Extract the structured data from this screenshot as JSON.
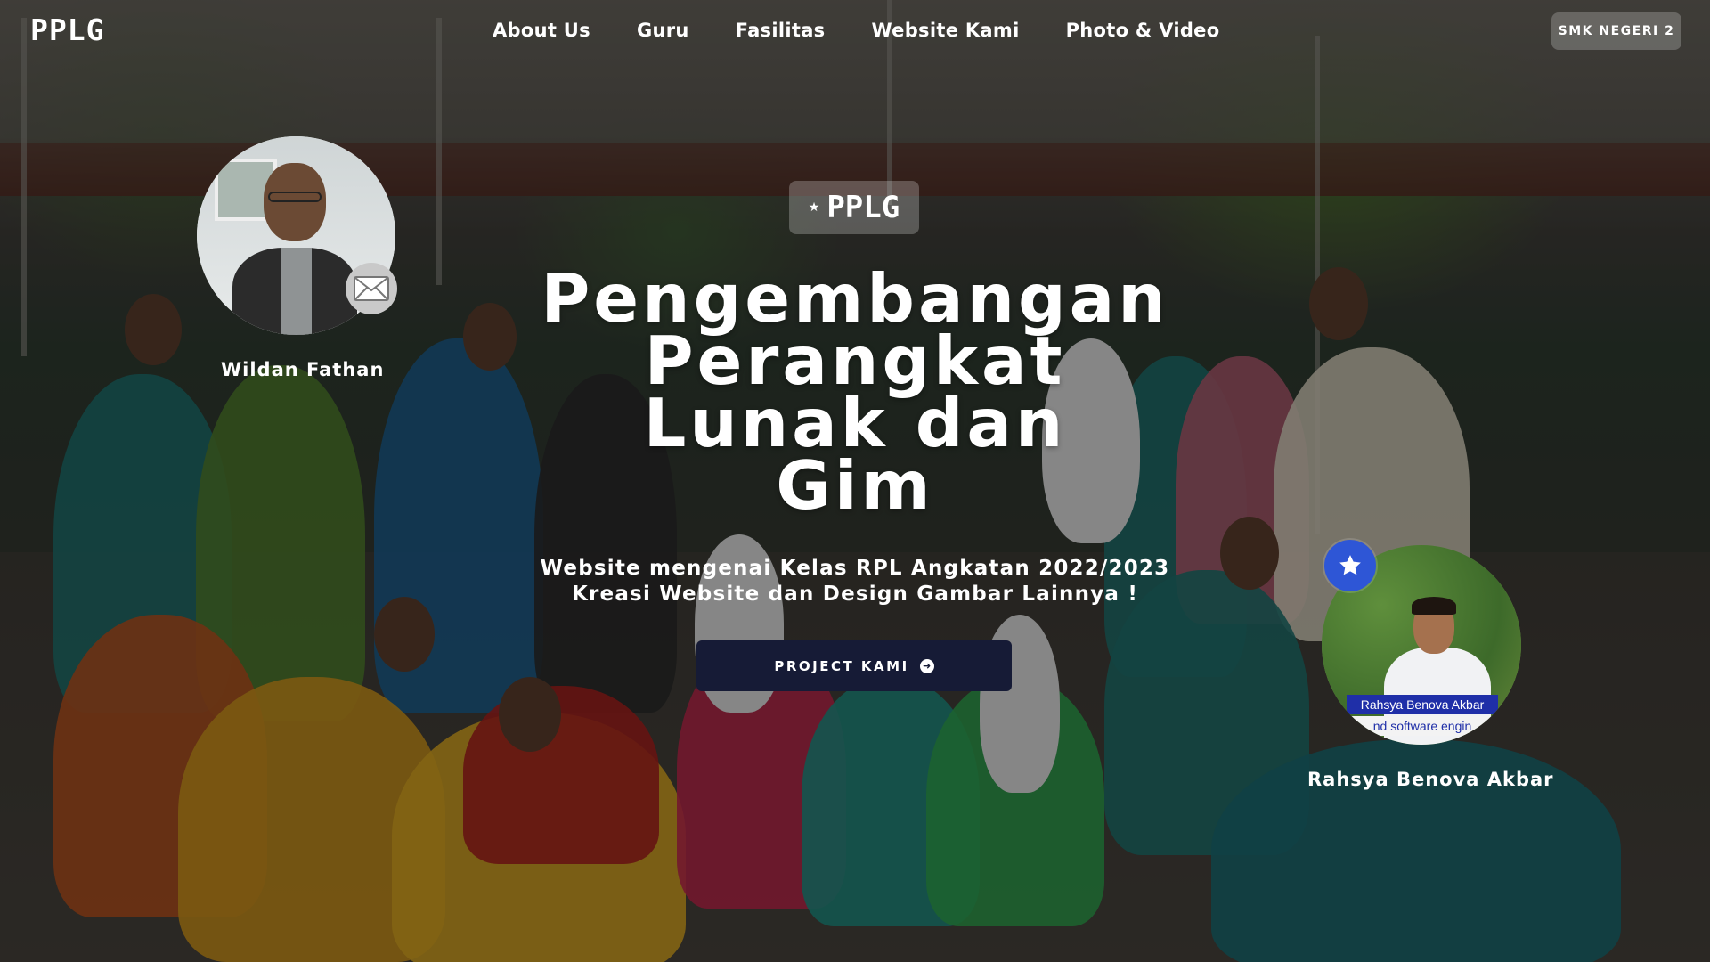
{
  "brand": {
    "logo": "PPLG",
    "school": "SMK NEGERI 2"
  },
  "nav": {
    "items": [
      {
        "label": "About Us"
      },
      {
        "label": "Guru"
      },
      {
        "label": "Fasilitas"
      },
      {
        "label": "Website Kami"
      },
      {
        "label": "Photo & Video"
      }
    ]
  },
  "hero": {
    "tag_star": "★",
    "tag": "PPLG",
    "title_lines": [
      "Pengembangan",
      "Perangkat",
      "Lunak dan",
      "Gim"
    ],
    "subtitle_lines": [
      "Website mengenai Kelas RPL Angkatan 2022/2023",
      "Kreasi Website dan Design Gambar Lainnya !"
    ],
    "cta_label": "PROJECT KAMI",
    "cta_icon": "arrow-right-circle-icon"
  },
  "profiles": [
    {
      "name": "Wildan Fathan",
      "badge_icon": "mail-icon"
    },
    {
      "name": "Rahsya Benova Akbar",
      "badge_icon": "star-icon",
      "photo_caption_name": "Rahsya Benova Akbar",
      "photo_caption_role": "nd software engin"
    }
  ],
  "colors": {
    "cta_bg": "#161b36",
    "star_badge": "#2e56d6",
    "mail_badge": "#c9c9c9"
  }
}
